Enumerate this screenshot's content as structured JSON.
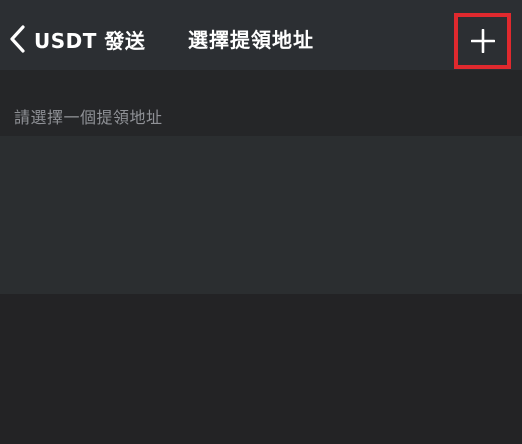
{
  "nav": {
    "back_label": "USDT 發送",
    "title": "選擇提領地址",
    "add_icon": "plus-icon",
    "back_icon": "chevron-left-icon"
  },
  "content": {
    "hint": "請選擇一個提領地址"
  },
  "colors": {
    "background": "#232325",
    "nav_background": "#2c2f33",
    "list_background": "#2b2e30",
    "hint_text": "#8f9196",
    "highlight": "#e0292e"
  }
}
